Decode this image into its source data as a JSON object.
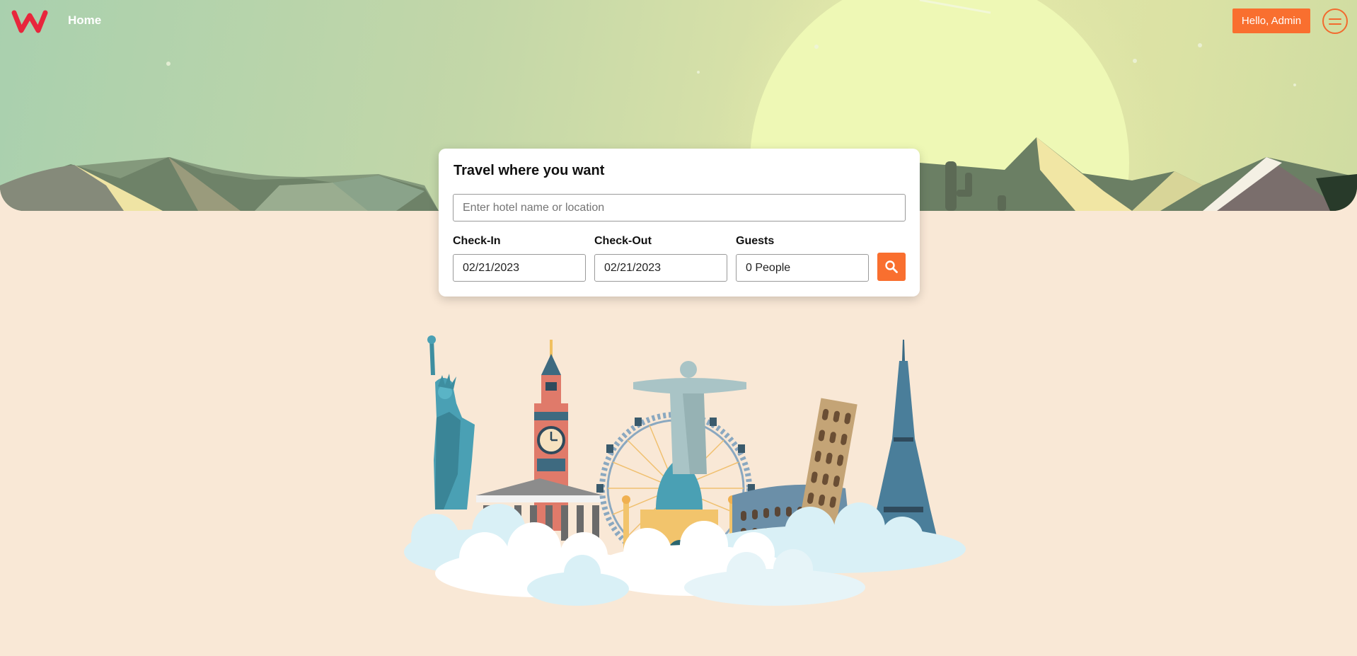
{
  "header": {
    "logo": "W",
    "nav_home": "Home",
    "greeting": "Hello, Admin",
    "menu_icon": "hamburger-circle-icon"
  },
  "search": {
    "title": "Travel where you want",
    "placeholder": "Enter hotel name or location",
    "checkin_label": "Check-In",
    "checkin_value": "02/21/2023",
    "checkout_label": "Check-Out",
    "checkout_value": "02/21/2023",
    "guests_label": "Guests",
    "guests_value": "0 People",
    "search_icon": "magnifier-icon"
  },
  "colors": {
    "accent": "#f96f2f",
    "background": "#f9e8d6",
    "logo": "#e8263c"
  }
}
